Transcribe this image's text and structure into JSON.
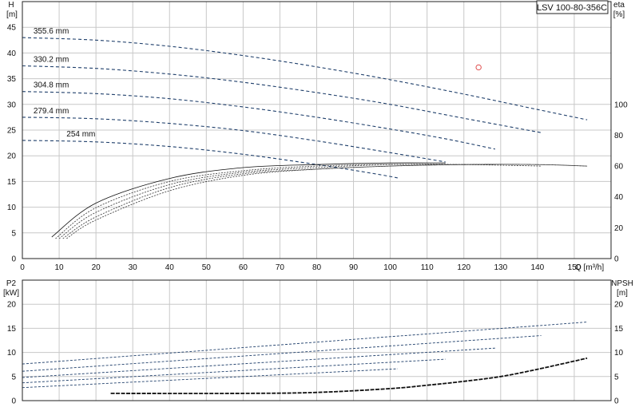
{
  "model": "LSV 100-80-356C",
  "colors": {
    "curve": "#1f3f6b",
    "marker": "#e05050",
    "grid": "#c8c8c8",
    "frame": "#222222"
  },
  "chart_data": [
    {
      "type": "line",
      "panel": "top",
      "x_label": "Q [m³/h]",
      "y_label": [
        "H",
        "[m]"
      ],
      "y2_label": [
        "eta",
        "[%]"
      ],
      "xlim": [
        0,
        160
      ],
      "ylim": [
        0,
        50
      ],
      "y2lim": [
        0,
        166.7
      ],
      "x_ticks": [
        0,
        10,
        20,
        30,
        40,
        50,
        60,
        70,
        80,
        90,
        100,
        110,
        120,
        130,
        140,
        150
      ],
      "y_ticks": [
        0,
        5,
        10,
        15,
        20,
        25,
        30,
        35,
        40,
        45
      ],
      "y2_ticks": [
        0,
        20,
        40,
        60,
        80,
        100
      ],
      "grid": true,
      "head_curves": [
        {
          "name": "355.6 mm",
          "x": [
            0,
            20,
            40,
            60,
            80,
            100,
            120,
            140,
            153.5
          ],
          "y": [
            43.0,
            42.5,
            41.3,
            39.5,
            37.3,
            34.8,
            32.0,
            29.0,
            27.0
          ]
        },
        {
          "name": "330.2 mm",
          "x": [
            0,
            20,
            40,
            60,
            80,
            100,
            120,
            141
          ],
          "y": [
            37.5,
            37.0,
            35.9,
            34.3,
            32.3,
            30.0,
            27.3,
            24.5
          ]
        },
        {
          "name": "304.8 mm",
          "x": [
            0,
            20,
            40,
            60,
            80,
            100,
            115,
            128.5
          ],
          "y": [
            32.5,
            32.1,
            31.1,
            29.5,
            27.5,
            25.2,
            23.3,
            21.3
          ]
        },
        {
          "name": "279.4 mm",
          "x": [
            0,
            20,
            40,
            60,
            80,
            100,
            115
          ],
          "y": [
            27.5,
            27.2,
            26.3,
            24.9,
            22.9,
            20.6,
            18.8
          ]
        },
        {
          "name": "254 mm",
          "x": [
            0,
            20,
            40,
            60,
            80,
            95,
            102
          ],
          "y": [
            23.0,
            22.7,
            21.8,
            20.3,
            18.3,
            16.6,
            15.7
          ]
        }
      ],
      "efficiency_curves": [
        {
          "x": [
            8,
            20,
            40,
            60,
            80,
            100,
            115
          ],
          "y": [
            14,
            36,
            52,
            59,
            61,
            62,
            62
          ]
        },
        {
          "x": [
            9,
            20,
            40,
            60,
            80,
            100,
            120,
            128.5
          ],
          "y": [
            13,
            33,
            50,
            57,
            60,
            61,
            61,
            61
          ]
        },
        {
          "x": [
            10,
            20,
            40,
            60,
            80,
            100,
            120,
            141
          ],
          "y": [
            13,
            30,
            48,
            56,
            59,
            61,
            61,
            60
          ]
        },
        {
          "x": [
            11,
            20,
            40,
            60,
            80,
            100,
            120,
            140,
            153.5
          ],
          "y": [
            13,
            27,
            46,
            55,
            58,
            60,
            61,
            61,
            60
          ]
        },
        {
          "x": [
            12,
            20,
            40,
            60,
            80,
            100,
            120,
            140,
            153.5
          ],
          "y": [
            13,
            25,
            44,
            54,
            58,
            60,
            61,
            61,
            60
          ]
        }
      ],
      "marker": {
        "x": 124,
        "y": 37.2
      }
    },
    {
      "type": "line",
      "panel": "bottom",
      "y_label": [
        "P2",
        "[kW]"
      ],
      "y2_label": [
        "NPSH",
        "[m]"
      ],
      "xlim": [
        0,
        160
      ],
      "ylim": [
        0,
        25
      ],
      "y2lim": [
        0,
        25
      ],
      "y_ticks": [
        0,
        5,
        10,
        15,
        20
      ],
      "y2_ticks": [
        0,
        5,
        10,
        15,
        20
      ],
      "grid": true,
      "power_curves": [
        {
          "x": [
            0,
            153.5
          ],
          "y": [
            7.6,
            16.3
          ]
        },
        {
          "x": [
            0,
            141
          ],
          "y": [
            6.1,
            13.5
          ]
        },
        {
          "x": [
            0,
            128.5
          ],
          "y": [
            4.8,
            10.9
          ]
        },
        {
          "x": [
            0,
            115
          ],
          "y": [
            3.7,
            8.6
          ]
        },
        {
          "x": [
            0,
            102
          ],
          "y": [
            2.7,
            6.6
          ]
        }
      ],
      "npsh_curve": {
        "x": [
          24,
          60,
          80,
          100,
          110,
          120,
          130,
          140,
          153.5
        ],
        "y": [
          1.5,
          1.5,
          1.7,
          2.5,
          3.2,
          4.0,
          5.0,
          6.5,
          8.8
        ]
      }
    }
  ]
}
